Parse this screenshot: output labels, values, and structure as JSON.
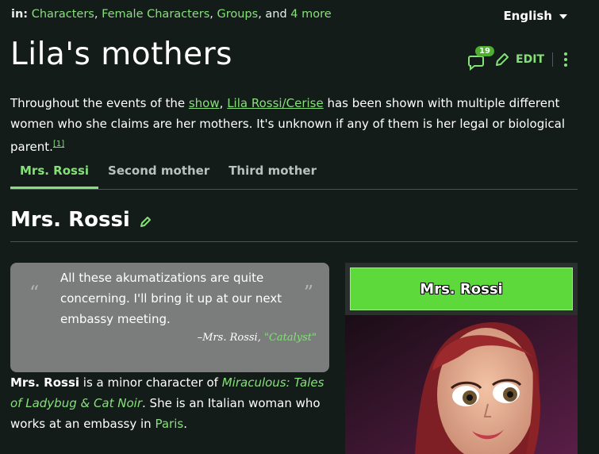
{
  "categories": {
    "prefix": "in:",
    "items": [
      "Characters",
      "Female Characters",
      "Groups"
    ],
    "sep1": ", ",
    "sep2": ", ",
    "conj": ", and ",
    "more": "4 more"
  },
  "language": {
    "label": "English"
  },
  "page": {
    "title": "Lila's mothers"
  },
  "actions": {
    "comment_count": "19",
    "edit_label": "EDIT"
  },
  "intro": {
    "t1": "Throughout the events of the ",
    "link_show": "show",
    "t2": ", ",
    "link_lila": "Lila Rossi/Cerise",
    "t3": " has been shown with multiple different women who she claims are her mothers. It's unknown if any of them is her legal or biological parent.",
    "ref": "[1]"
  },
  "tabs": [
    {
      "label": "Mrs. Rossi"
    },
    {
      "label": "Second mother"
    },
    {
      "label": "Third mother"
    }
  ],
  "section": {
    "title": "Mrs. Rossi"
  },
  "quote": {
    "text": "All these akumatizations are quite concerning. I'll bring it up at our next embassy meeting.",
    "cite_prefix": "–Mrs. Rossi, ",
    "cite_link": "\"Catalyst\""
  },
  "description": {
    "bold": "Mrs. Rossi",
    "t1": " is a minor character of ",
    "link_show": "Miraculous: Tales of Ladybug & Cat Noir",
    "t2": ". She is an Italian woman who works at an embassy in ",
    "link_place": "Paris",
    "t3": "."
  },
  "infobox": {
    "title": "Mrs. Rossi"
  },
  "colors": {
    "accent": "#86e07a",
    "background": "#141c1a",
    "infobox_header": "#5ed93b"
  }
}
